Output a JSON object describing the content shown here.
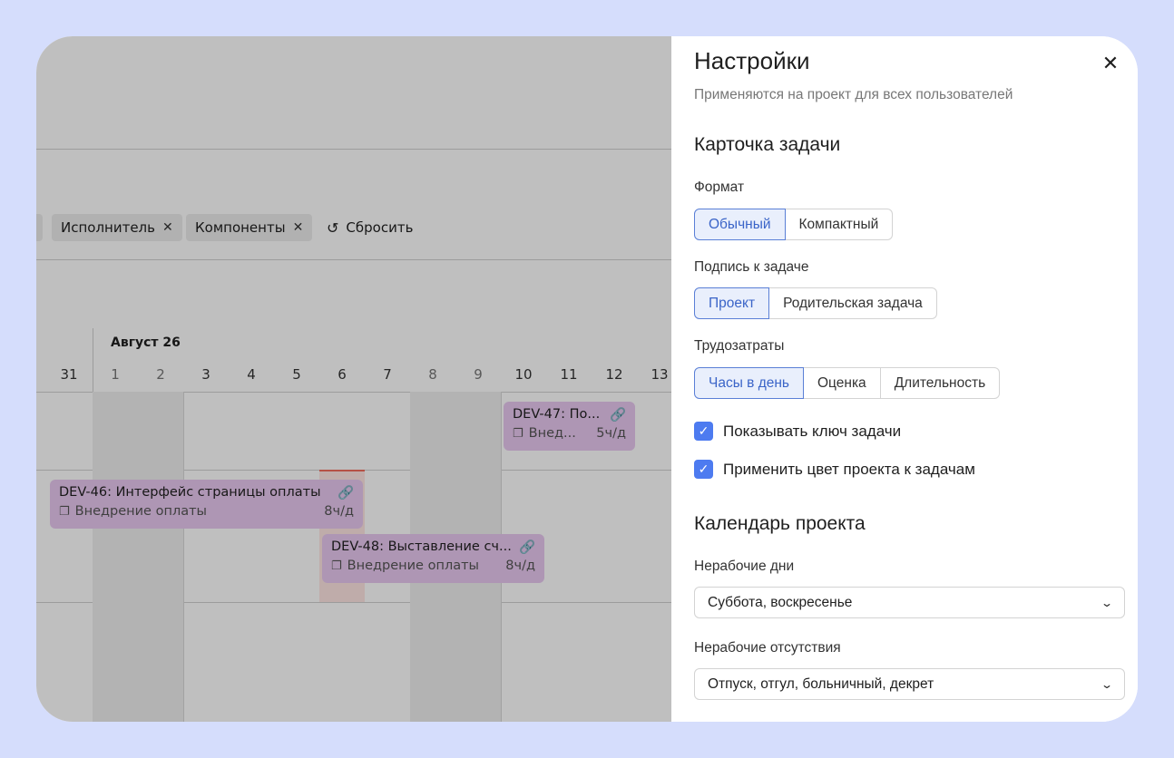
{
  "timeline": {
    "filters": [
      {
        "label": "Исполнитель",
        "close": "✕"
      },
      {
        "label": "Компоненты",
        "close": "✕"
      }
    ],
    "reset": {
      "icon": "reset-icon",
      "label": "Сбросить"
    },
    "month": "Август 26",
    "days": [
      "31",
      "1",
      "2",
      "3",
      "4",
      "5",
      "6",
      "7",
      "8",
      "9",
      "10",
      "11",
      "12",
      "13"
    ],
    "tasks": [
      {
        "title": "DEV-47: По...",
        "epic": "Внед...",
        "hours": "5ч/д"
      },
      {
        "title": "DEV-46: Интерфейс страницы оплаты",
        "epic": "Внедрение оплаты",
        "hours": "8ч/д"
      },
      {
        "title": "DEV-48: Выставление сч...",
        "epic": "Внедрение оплаты",
        "hours": "8ч/д"
      }
    ]
  },
  "panel": {
    "title": "Настройки",
    "subtitle": "Применяются на проект для всех пользователей",
    "card_section": "Карточка задачи",
    "format": {
      "label": "Формат",
      "options": [
        "Обычный",
        "Компактный"
      ],
      "selected": "Обычный"
    },
    "caption": {
      "label": "Подпись к задаче",
      "options": [
        "Проект",
        "Родительская задача"
      ],
      "selected": "Проект"
    },
    "effort": {
      "label": "Трудозатраты",
      "options": [
        "Часы в день",
        "Оценка",
        "Длительность"
      ],
      "selected": "Часы в день"
    },
    "checkboxes": [
      {
        "label": "Показывать ключ задачи",
        "checked": true
      },
      {
        "label": "Применить цвет проекта к задачам",
        "checked": true
      }
    ],
    "calendar_section": "Календарь проекта",
    "nonworking_days": {
      "label": "Нерабочие дни",
      "value": "Суббота, воскресенье"
    },
    "nonworking_absences": {
      "label": "Нерабочие отсутствия",
      "value": "Отпуск, отгул, больничный, декрет"
    }
  },
  "colors": {
    "page_bg": "#d5ddfc",
    "accent": "#4d7bf0",
    "task_bg": "#e9c9f0",
    "today_line": "#f26d5c"
  }
}
